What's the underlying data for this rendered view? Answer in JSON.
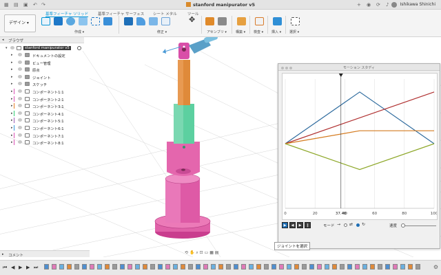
{
  "window": {
    "title": "stanford manipurator v5",
    "user": "Ishikawa Shinichi",
    "titlebar_left_icons": [
      "grid-icon",
      "file-icon",
      "save-icon",
      "undo-icon",
      "redo-icon"
    ],
    "titlebar_right_icons": [
      "plus-icon",
      "badge-icon",
      "refresh-icon",
      "bell-icon",
      "help-icon"
    ]
  },
  "ribbon": {
    "workspace_label": "デザイン ▾",
    "tabs": [
      "基準フィーチャ ソリッド",
      "基準フィーチャ サーフェス",
      "シート メタル",
      "ツール"
    ],
    "active_tab": 0,
    "groups": [
      "作成 ▾",
      "修正 ▾",
      "アセンブリ ▾",
      "構築 ▾",
      "検査 ▾",
      "挿入 ▾",
      "選択 ▾"
    ],
    "accent": "#0696d7"
  },
  "browser": {
    "title": "ブラウザ",
    "root": "stanford manipurator v5",
    "items": [
      {
        "label": "ドキュメントの設定",
        "icon": "gear-icon",
        "color": ""
      },
      {
        "label": "ビュー管理",
        "icon": "folder-icon",
        "color": ""
      },
      {
        "label": "原点",
        "icon": "folder-icon",
        "color": ""
      },
      {
        "label": "ジョイント",
        "icon": "folder-icon",
        "color": ""
      },
      {
        "label": "スケッチ",
        "icon": "folder-icon",
        "color": ""
      },
      {
        "label": "コンポーネント1:1",
        "icon": "component-icon",
        "color": "#d94fb4"
      },
      {
        "label": "コンポーネント2:1",
        "icon": "component-icon",
        "color": "#d94fb4"
      },
      {
        "label": "コンポーネント3:1",
        "icon": "component-icon",
        "color": "#e67e22"
      },
      {
        "label": "コンポーネント4:1",
        "icon": "component-icon",
        "color": "#2ecc71"
      },
      {
        "label": "コンポーネント5:1",
        "icon": "component-icon",
        "color": "#9b59b6"
      },
      {
        "label": "コンポーネント6:1",
        "icon": "component-icon",
        "color": "#3498db"
      },
      {
        "label": "コンポーネント7:1",
        "icon": "component-icon",
        "color": "#d94fb4"
      },
      {
        "label": "コンポーネント8:1",
        "icon": "component-icon",
        "color": "#d94fb4"
      }
    ]
  },
  "motion_study": {
    "title": "モーション スタディ",
    "mode_label": "モード",
    "speed_label": "速度",
    "tooltip": "ジョイントを選択",
    "controls": [
      "play-icon",
      "step-back-icon",
      "step-forward-icon",
      "pause-icon"
    ]
  },
  "chart_data": {
    "type": "line",
    "title": "",
    "xlabel": "",
    "ylabel": "",
    "xlim": [
      0,
      100
    ],
    "ylim": [
      -1,
      1
    ],
    "x_ticks": [
      0,
      20,
      40,
      60,
      80,
      100
    ],
    "playhead": 37.4,
    "playhead_label": "37.40",
    "grid": true,
    "series": [
      {
        "color": "#2e6b9e",
        "points": [
          [
            0,
            0.0
          ],
          [
            50,
            0.8
          ],
          [
            100,
            0.0
          ]
        ]
      },
      {
        "color": "#b03030",
        "points": [
          [
            0,
            0.0
          ],
          [
            100,
            0.8
          ]
        ]
      },
      {
        "color": "#d47a1e",
        "points": [
          [
            0,
            0.0
          ],
          [
            50,
            0.2
          ],
          [
            100,
            0.2
          ]
        ]
      },
      {
        "color": "#8ea82a",
        "points": [
          [
            0,
            0.0
          ],
          [
            50,
            -0.4
          ],
          [
            100,
            0.0
          ]
        ]
      }
    ]
  },
  "bottom": {
    "comment_label": "コメント",
    "nav_icons": [
      "orbit-icon",
      "pan-icon",
      "zoom-icon",
      "fit-icon",
      "display-icon",
      "grid-icon",
      "layout-icon"
    ],
    "timeline_controls": [
      "first-icon",
      "prev-icon",
      "play-icon",
      "next-icon",
      "last-icon"
    ]
  }
}
